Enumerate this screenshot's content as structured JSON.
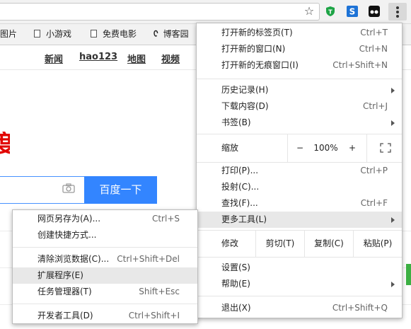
{
  "toolbar": {
    "star_icon": "star-icon",
    "extensions": [
      "shield-extension-icon",
      "s-extension-icon",
      "media-extension-icon"
    ],
    "menu_icon": "three-dots-menu-icon"
  },
  "bookmarks": [
    "图片",
    "小游戏",
    "免费电影",
    "博客园"
  ],
  "page": {
    "nav_links": [
      "新闻",
      "hao123",
      "地图",
      "视频"
    ],
    "search_button": "百度一下",
    "brand_red": "#e10601",
    "button_blue": "#3385ff"
  },
  "main_menu": {
    "new_tab": {
      "label": "打开新的标签页(T)",
      "shortcut": "Ctrl+T"
    },
    "new_window": {
      "label": "打开新的窗口(N)",
      "shortcut": "Ctrl+N"
    },
    "new_incognito": {
      "label": "打开新的无痕窗口(I)",
      "shortcut": "Ctrl+Shift+N"
    },
    "history": {
      "label": "历史记录(H)"
    },
    "downloads": {
      "label": "下载内容(D)",
      "shortcut": "Ctrl+J"
    },
    "bookmarks": {
      "label": "书签(B)"
    },
    "zoom": {
      "label": "缩放",
      "minus": "−",
      "value": "100%",
      "plus": "+"
    },
    "print": {
      "label": "打印(P)...",
      "shortcut": "Ctrl+P"
    },
    "cast": {
      "label": "投射(C)..."
    },
    "find": {
      "label": "查找(F)...",
      "shortcut": "Ctrl+F"
    },
    "more_tools": {
      "label": "更多工具(L)"
    },
    "edit": {
      "label": "修改",
      "cut": "剪切(T)",
      "copy": "复制(C)",
      "paste": "粘贴(P)"
    },
    "settings": {
      "label": "设置(S)"
    },
    "help": {
      "label": "帮助(E)"
    },
    "exit": {
      "label": "退出(X)",
      "shortcut": "Ctrl+Shift+Q"
    }
  },
  "submenu": {
    "save_page": {
      "label": "网页另存为(A)...",
      "shortcut": "Ctrl+S"
    },
    "create_shortcut": {
      "label": "创建快捷方式..."
    },
    "clear_data": {
      "label": "清除浏览数据(C)...",
      "shortcut": "Ctrl+Shift+Del"
    },
    "extensions": {
      "label": "扩展程序(E)"
    },
    "task_manager": {
      "label": "任务管理器(T)",
      "shortcut": "Shift+Esc"
    },
    "dev_tools": {
      "label": "开发者工具(D)",
      "shortcut": "Ctrl+Shift+I"
    }
  }
}
